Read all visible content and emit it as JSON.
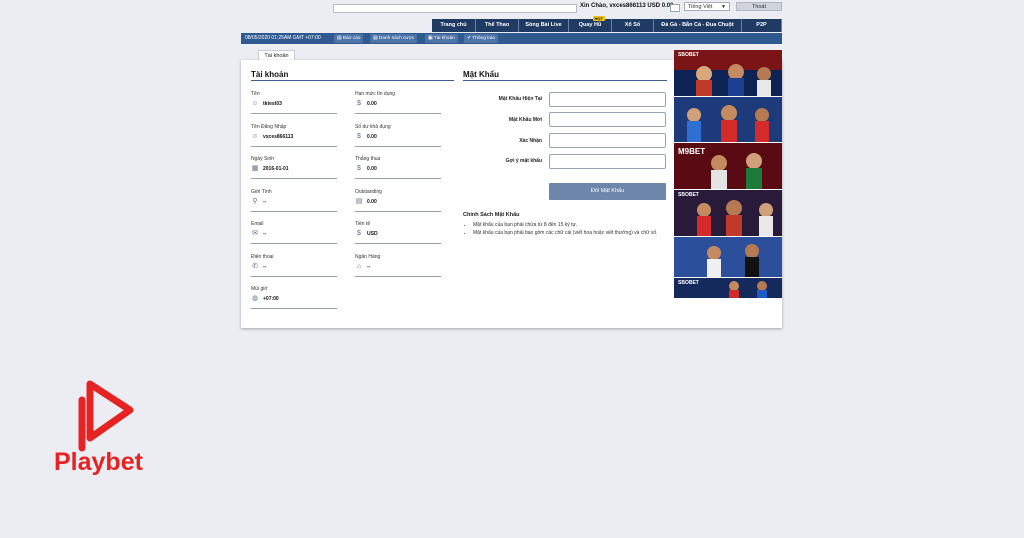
{
  "header": {
    "greeting": "Xin Chào, vxces866113 USD 0.00",
    "language": "Tiếng Việt",
    "logout_label": "Thoát"
  },
  "nav": {
    "items": [
      {
        "label": "Trang chủ"
      },
      {
        "label": "Thể Thao"
      },
      {
        "label": "Sòng Bài Live"
      },
      {
        "label": "Quay Hũ",
        "badge": "HOT"
      },
      {
        "label": "Xổ Số"
      },
      {
        "label": "Đá Gà - Bắn Cá - Đua Chuột"
      },
      {
        "label": "P2P"
      }
    ]
  },
  "subbar": {
    "datetime": "08/05/2020 01:25AM GMT +07:00",
    "buttons": [
      {
        "label": "Báo cáo",
        "icon": "report-icon"
      },
      {
        "label": "Danh sách cược",
        "icon": "list-icon"
      },
      {
        "label": "Tài khoản",
        "icon": "account-icon"
      },
      {
        "label": "Thông báo",
        "icon": "notify-icon"
      }
    ]
  },
  "tab_label": "Tài khoản",
  "account": {
    "title": "Tài khoản",
    "left": [
      {
        "label": "Tên",
        "value": "tktest03",
        "icon": "user-icon"
      },
      {
        "label": "Tên Đăng Nhập",
        "value": "vxces866113",
        "icon": "user-circle-icon"
      },
      {
        "label": "Ngày Sinh",
        "value": "2016-01-01",
        "icon": "calendar-icon"
      },
      {
        "label": "Giới Tính",
        "value": "--",
        "icon": "gender-icon"
      },
      {
        "label": "Email",
        "value": "--",
        "icon": "mail-icon"
      },
      {
        "label": "Điện thoại",
        "value": "--",
        "icon": "phone-icon"
      },
      {
        "label": "Múi giờ",
        "value": "+07:00",
        "icon": "globe-icon"
      }
    ],
    "right": [
      {
        "label": "Hạn mức tín dụng",
        "value": "0.00",
        "icon": "coin-icon"
      },
      {
        "label": "Số dư khả dụng",
        "value": "0.00",
        "icon": "coin-icon"
      },
      {
        "label": "Thắng thua",
        "value": "0.00",
        "icon": "coin-icon"
      },
      {
        "label": "Outstanding",
        "value": "0.00",
        "icon": "receipt-icon"
      },
      {
        "label": "Tiền tệ",
        "value": "USD",
        "icon": "coin-icon"
      },
      {
        "label": "Ngân Hàng",
        "value": "--",
        "icon": "bank-icon"
      }
    ]
  },
  "password": {
    "title": "Mật Khẩu",
    "fields": [
      {
        "label": "Mật Khẩu Hiện Tại",
        "value": ""
      },
      {
        "label": "Mật Khẩu Mới",
        "value": ""
      },
      {
        "label": "Xác Nhận",
        "value": ""
      },
      {
        "label": "Gợi ý mật khẩu",
        "value": ""
      }
    ],
    "submit_label": "Đổi Mật Khẩu",
    "policy_title": "Chính Sách Mật Khẩu",
    "policy_items": [
      "Mật khẩu của bạn phải chứa từ 8 đến 15 ký tự.",
      "Mật khẩu của bạn phải bao gồm các chữ cái (viết hoa hoặc viết thường) và chữ số."
    ]
  },
  "banners": [
    {
      "label": "SBOBET",
      "color": "#7a1416"
    },
    {
      "label": "",
      "color": "#1d3b7a"
    },
    {
      "label": "M9BET",
      "color": "#5a0a12"
    },
    {
      "label": "SBOBET",
      "color": "#2a1a3a"
    },
    {
      "label": "",
      "color": "#2b4f9a"
    },
    {
      "label": "SBOBET",
      "color": "#142a5c"
    }
  ],
  "brand": {
    "name": "Playbet",
    "color": "#e52323"
  }
}
